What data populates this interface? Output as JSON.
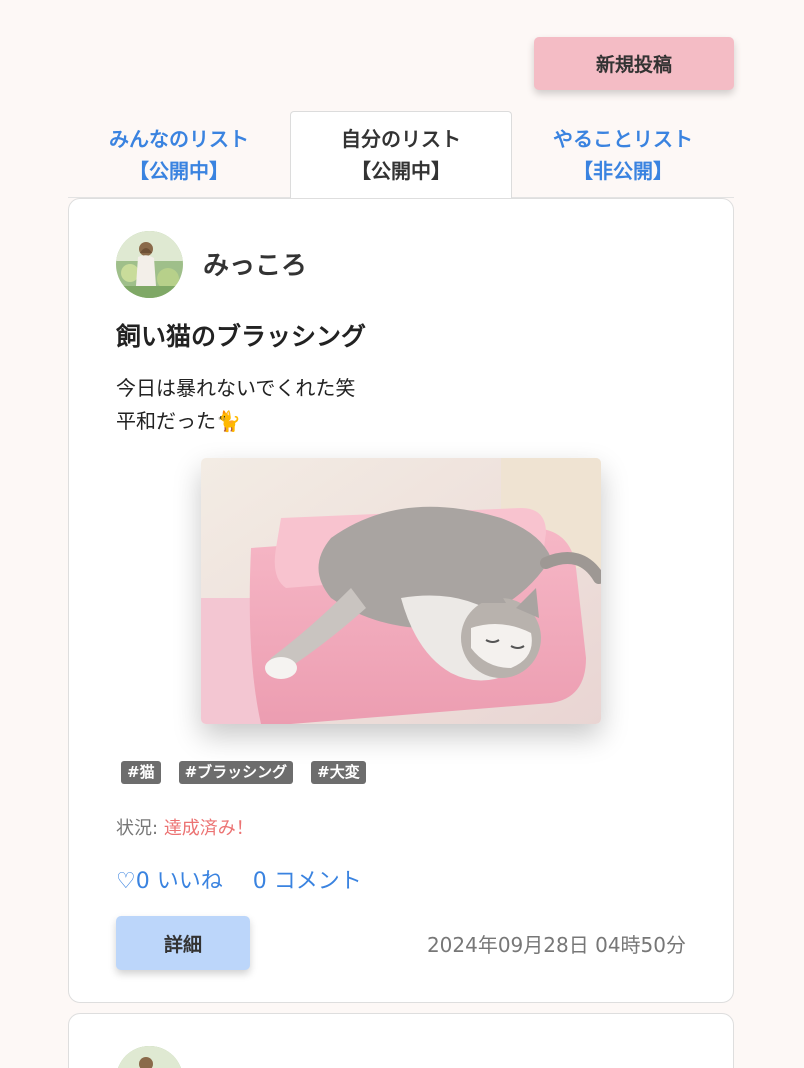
{
  "header": {
    "new_post_label": "新規投稿"
  },
  "tabs": [
    {
      "line1": "みんなのリスト",
      "line2": "【公開中】",
      "active": false
    },
    {
      "line1": "自分のリスト",
      "line2": "【公開中】",
      "active": true
    },
    {
      "line1": "やることリスト",
      "line2": "【非公開】",
      "active": false
    }
  ],
  "post": {
    "username": "みっころ",
    "title": "飼い猫のブラッシング",
    "body_line1": "今日は暴れないでくれた笑",
    "body_line2": "平和だった🐈",
    "tags": [
      "#猫",
      "#ブラッシング",
      "#大変"
    ],
    "status_label": "状況:",
    "status_value": "達成済み！",
    "likes": "♡0 いいね",
    "comments": "0 コメント",
    "detail_label": "詳細",
    "timestamp": "2024年09月28日 04時50分"
  },
  "colors": {
    "accent_blue": "#3a83e0",
    "new_post_button": "#f4bcc5",
    "detail_button": "#bcd6fa",
    "status_done": "#ec7373",
    "tag_bg": "#6d6d6d"
  }
}
